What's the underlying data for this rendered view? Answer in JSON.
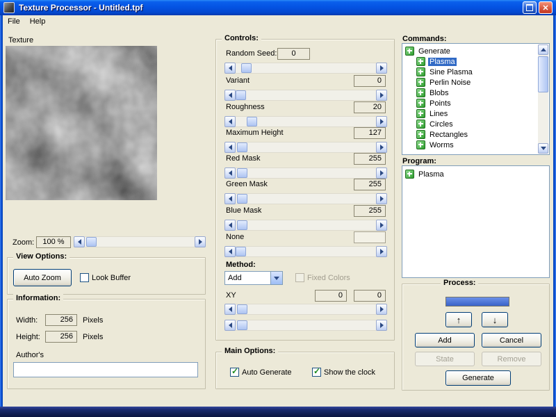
{
  "window": {
    "title": "Texture Processor - Untitled.tpf"
  },
  "menu": {
    "file": "File",
    "help": "Help"
  },
  "icons": {
    "close-icon": "✕",
    "maximize-icon": "css-square",
    "tree-plus-icon": "green-plus",
    "scroll-arrow-icons": "css-triangles",
    "checkbox-check": "✓",
    "combo-arrow": "css-triangle-down"
  },
  "left": {
    "texture_label": "Texture",
    "zoom_label": "Zoom:",
    "zoom_value": "100 %",
    "view_options": {
      "title": "View Options:",
      "auto_zoom_button": "Auto Zoom",
      "look_buffer_label": "Look Buffer"
    },
    "information": {
      "title": "Information:",
      "width_label": "Width:",
      "width_value": "256",
      "width_unit": "Pixels",
      "height_label": "Height:",
      "height_value": "256",
      "height_unit": "Pixels",
      "author_label": "Author's",
      "author_value": ""
    }
  },
  "controls": {
    "title": "Controls:",
    "rows": [
      {
        "label": "Random Seed:",
        "value": "0"
      },
      {
        "label": "Variant",
        "value": "0"
      },
      {
        "label": "Roughness",
        "value": "20"
      },
      {
        "label": "Maximum Height",
        "value": "127"
      },
      {
        "label": "Red Mask",
        "value": "255"
      },
      {
        "label": "Green Mask",
        "value": "255"
      },
      {
        "label": "Blue Mask",
        "value": "255"
      },
      {
        "label": "None",
        "value": ""
      }
    ],
    "method_label": "Method:",
    "method_value": "Add",
    "fixed_colors_label": "Fixed Colors",
    "xy_label": "XY",
    "xy_x": "0",
    "xy_y": "0"
  },
  "main_options": {
    "title": "Main Options:",
    "auto_generate_label": "Auto Generate",
    "show_clock_label": "Show the clock"
  },
  "commands": {
    "title": "Commands:",
    "items": [
      {
        "label": "Generate"
      },
      {
        "label": "Plasma"
      },
      {
        "label": "Sine Plasma"
      },
      {
        "label": "Perlin Noise"
      },
      {
        "label": "Blobs"
      },
      {
        "label": "Points"
      },
      {
        "label": "Lines"
      },
      {
        "label": "Circles"
      },
      {
        "label": "Rectangles"
      },
      {
        "label": "Worms"
      }
    ],
    "selected_item": "Plasma"
  },
  "program": {
    "title": "Program:",
    "items": [
      {
        "label": "Plasma"
      }
    ]
  },
  "process": {
    "title": "Process:",
    "up_button": "↑",
    "down_button": "↓",
    "add_button": "Add",
    "cancel_button": "Cancel",
    "state_button": "State",
    "remove_button": "Remove",
    "generate_button": "Generate"
  },
  "colors": {
    "selection": "#316ac5",
    "progress_fill": "#3a63c8",
    "tree_icon_green": "#2f9e2f",
    "titlebar_blue": "#0453e3",
    "background_beige": "#ece9d8"
  }
}
